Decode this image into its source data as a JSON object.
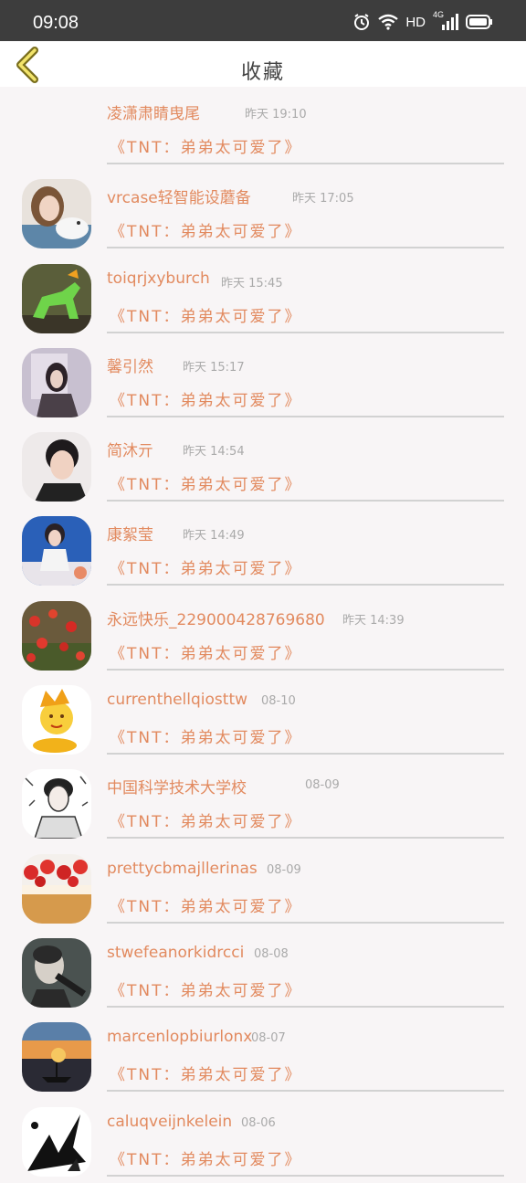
{
  "status": {
    "time": "09:08",
    "network": "HD",
    "signal_label": "4G"
  },
  "header": {
    "title": "收藏"
  },
  "colors": {
    "accent": "#e28a5f",
    "divider": "#d2d2d2",
    "time_text": "#aaaaaa"
  },
  "items": [
    {
      "name": "凌潇肃睛曳尾",
      "time": "昨天 19:10",
      "content": "《TNT：弟弟太可爱了》",
      "avatar": "none"
    },
    {
      "name": "vrcase轻智能设蘑备",
      "time": "昨天 17:05",
      "content": "《TNT：弟弟太可爱了》",
      "avatar": "girl-with-rabbit"
    },
    {
      "name": "toiqrjxyburch",
      "time": "昨天 15:45",
      "content": "《TNT：弟弟太可爱了》",
      "avatar": "green-horse"
    },
    {
      "name": "馨引然",
      "time": "昨天 15:17",
      "content": "《TNT：弟弟太可爱了》",
      "avatar": "girl-mirror"
    },
    {
      "name": "简沐亓",
      "time": "昨天 14:54",
      "content": "《TNT：弟弟太可爱了》",
      "avatar": "boy-portrait"
    },
    {
      "name": "康絮莹",
      "time": "昨天 14:49",
      "content": "《TNT：弟弟太可爱了》",
      "avatar": "boy-blue-background"
    },
    {
      "name": "永远快乐_229000428769680",
      "time": "昨天 14:39",
      "content": "《TNT：弟弟太可爱了》",
      "avatar": "red-tulips"
    },
    {
      "name": "currenthellqiosttw",
      "time": "08-10",
      "content": "《TNT：弟弟太可爱了》",
      "avatar": "golden-cartoon"
    },
    {
      "name": "中国科学技术大学校",
      "time": "08-09",
      "content": "《TNT：弟弟太可爱了》",
      "avatar": "sketch-girl"
    },
    {
      "name": "prettycbmajllerinas",
      "time": "08-09",
      "content": "《TNT：弟弟太可爱了》",
      "avatar": "strawberry-cake"
    },
    {
      "name": "stwefeanorkidrcci",
      "time": "08-08",
      "content": "《TNT：弟弟太可爱了》",
      "avatar": "man-singing"
    },
    {
      "name": "marcenlopbiurlonx",
      "time": "08-07",
      "content": "《TNT：弟弟太可爱了》",
      "avatar": "sunset-boat"
    },
    {
      "name": "caluqveijnkelein",
      "time": "08-06",
      "content": "《TNT：弟弟太可爱了》",
      "avatar": "ink-sketch"
    }
  ]
}
